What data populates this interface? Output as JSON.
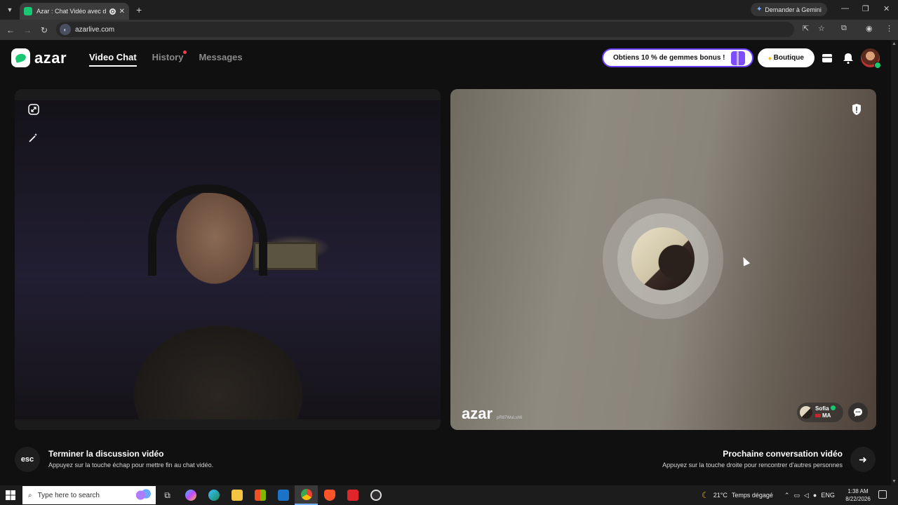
{
  "browser": {
    "tab_title": "Azar : Chat Vidéo avec de n",
    "gemini_label": "Demander à Gemini",
    "url": "azarlive.com"
  },
  "app": {
    "logo_text": "azar",
    "nav": [
      {
        "label": "Video Chat",
        "active": true
      },
      {
        "label": "History",
        "active": false,
        "dot": true
      },
      {
        "label": "Messages",
        "active": false
      }
    ],
    "promo_label": "Obtiens 10 % de gemmes bonus !",
    "boutique_label": "Boutique"
  },
  "remote": {
    "watermark": "azar",
    "watermark_code": "pR87WuLsh6",
    "partner_name": "Sofia",
    "partner_country": "MA"
  },
  "hints": {
    "esc_key": "esc",
    "end_title": "Terminer la discussion vidéo",
    "end_sub": "Appuyez sur la touche échap pour mettre fin au chat vidéo.",
    "next_title": "Prochaine conversation vidéo",
    "next_sub": "Appuyez sur la touche droite pour rencontrer d'autres personnes"
  },
  "taskbar": {
    "search_placeholder": "Type here to search",
    "weather": "21°C",
    "weather_desc": "Temps dégagé",
    "lang": "ENG",
    "time": "1:38 AM",
    "date": "8/22/2026"
  },
  "colors": {
    "accent": "#19c773",
    "promo_border": "#6b3dff",
    "notif_dot": "#ff3b4d"
  }
}
